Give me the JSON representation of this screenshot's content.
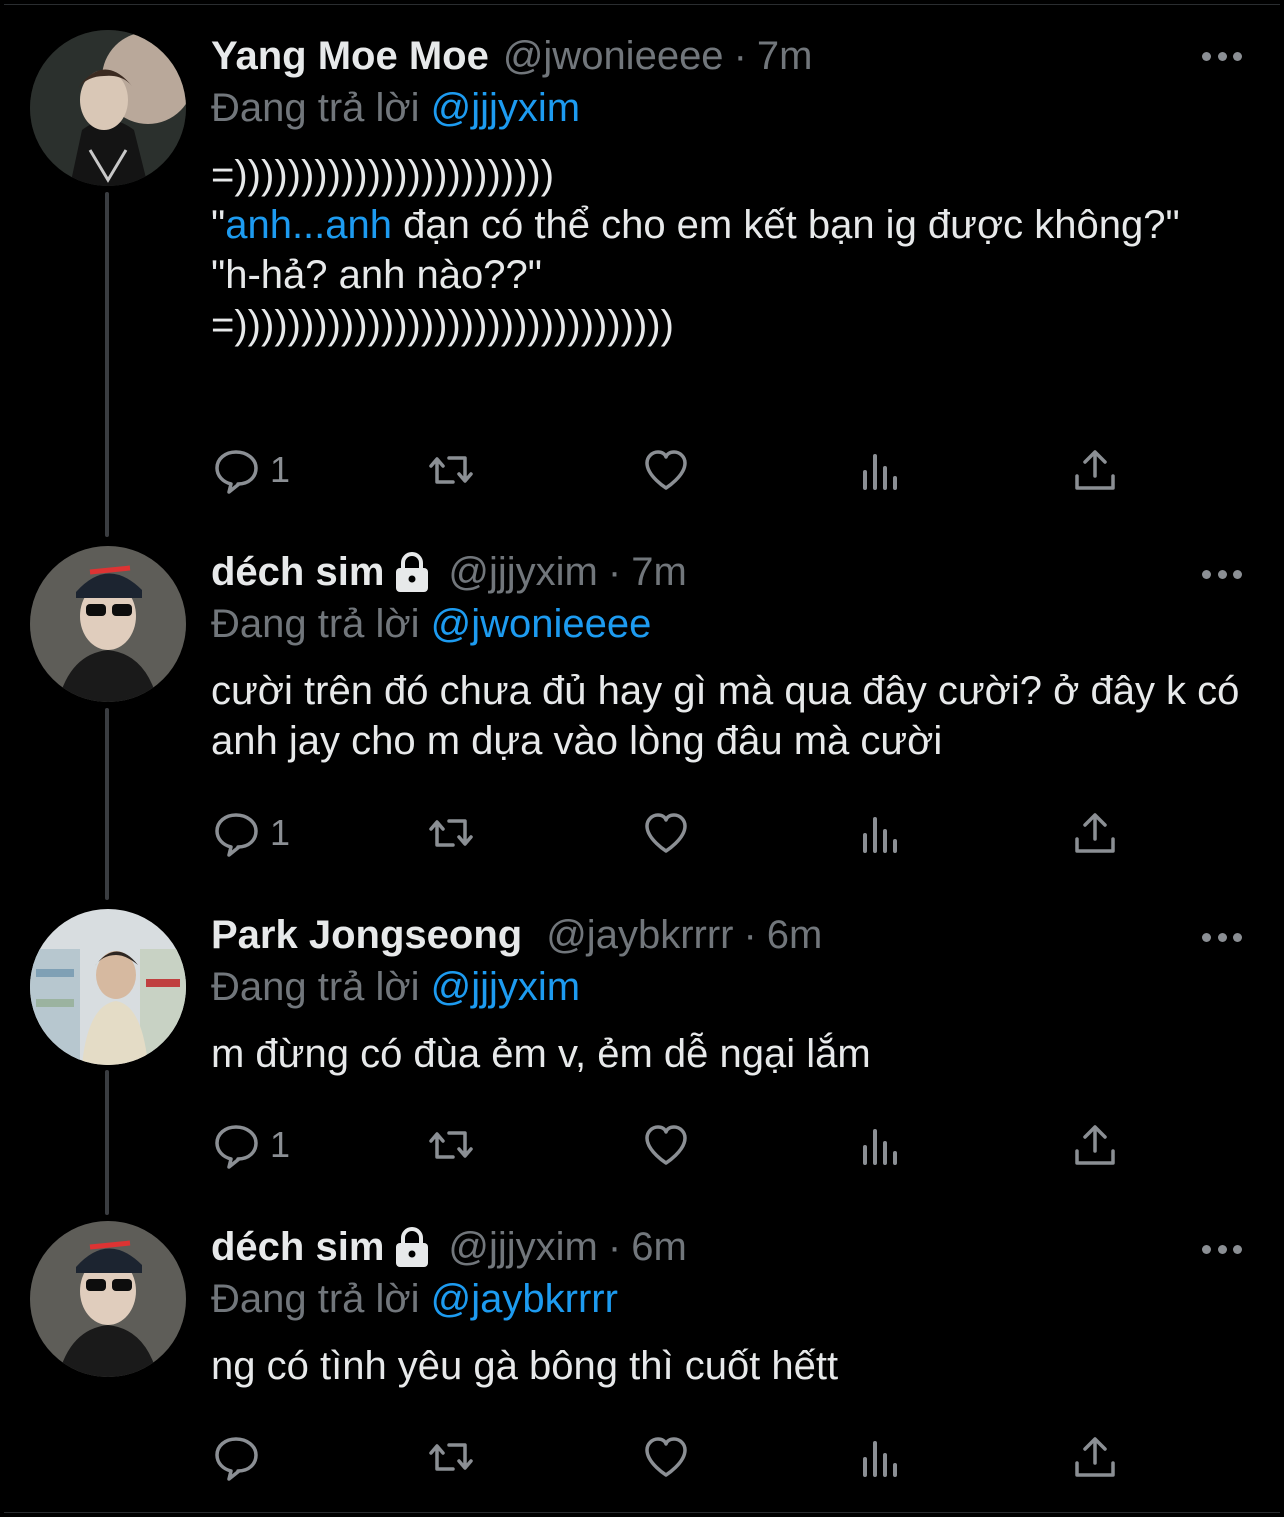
{
  "tweets": [
    {
      "name": "Yang Moe Moe",
      "handle": "@jwonieeee",
      "time": "7m",
      "locked": false,
      "replying_prefix": "Đang trả lời ",
      "replying_to": "@jjjyxim",
      "line1": "=))))))))))))))))))))))))",
      "line2_open_quote": "\"",
      "line2_link": "anh...anh",
      "line2_rest": " đạn có thể cho em kết bạn ig được không?\"",
      "line3": "\"h-hả? anh nào??\"",
      "line4": "=)))))))))))))))))))))))))))))))))",
      "reply_count": "1",
      "avatar_icon": "avatar-photo"
    },
    {
      "name": "déch sim",
      "handle": "@jjjyxim",
      "time": "7m",
      "locked": true,
      "replying_prefix": "Đang trả lời ",
      "replying_to": "@jwonieeee",
      "text": "cười trên đó chưa đủ hay gì mà qua đây cười? ở đây k có anh jay cho m dựa vào lòng đâu mà cười",
      "reply_count": "1",
      "avatar_icon": "avatar-photo"
    },
    {
      "name": "Park Jongseong",
      "handle": "@jaybkrrrr",
      "time": "6m",
      "locked": false,
      "replying_prefix": "Đang trả lời ",
      "replying_to": "@jjjyxim",
      "text": "m đừng có đùa ẻm v, ẻm dễ ngại lắm",
      "reply_count": "1",
      "avatar_icon": "avatar-photo"
    },
    {
      "name": "déch sim",
      "handle": "@jjjyxim",
      "time": "6m",
      "locked": true,
      "replying_prefix": "Đang trả lời ",
      "replying_to": "@jaybkrrrr",
      "text": "ng có tình yêu gà bông thì cuốt hếtt",
      "reply_count": "",
      "avatar_icon": "avatar-photo"
    }
  ],
  "separator": "·",
  "colors": {
    "background": "#000000",
    "text": "#e7e9ea",
    "muted": "#71767b",
    "link": "#1d9bf0",
    "thread_line": "#3a3d41"
  },
  "icons": [
    "reply-icon",
    "retweet-icon",
    "like-icon",
    "views-icon",
    "share-icon",
    "more-icon",
    "lock-icon"
  ]
}
